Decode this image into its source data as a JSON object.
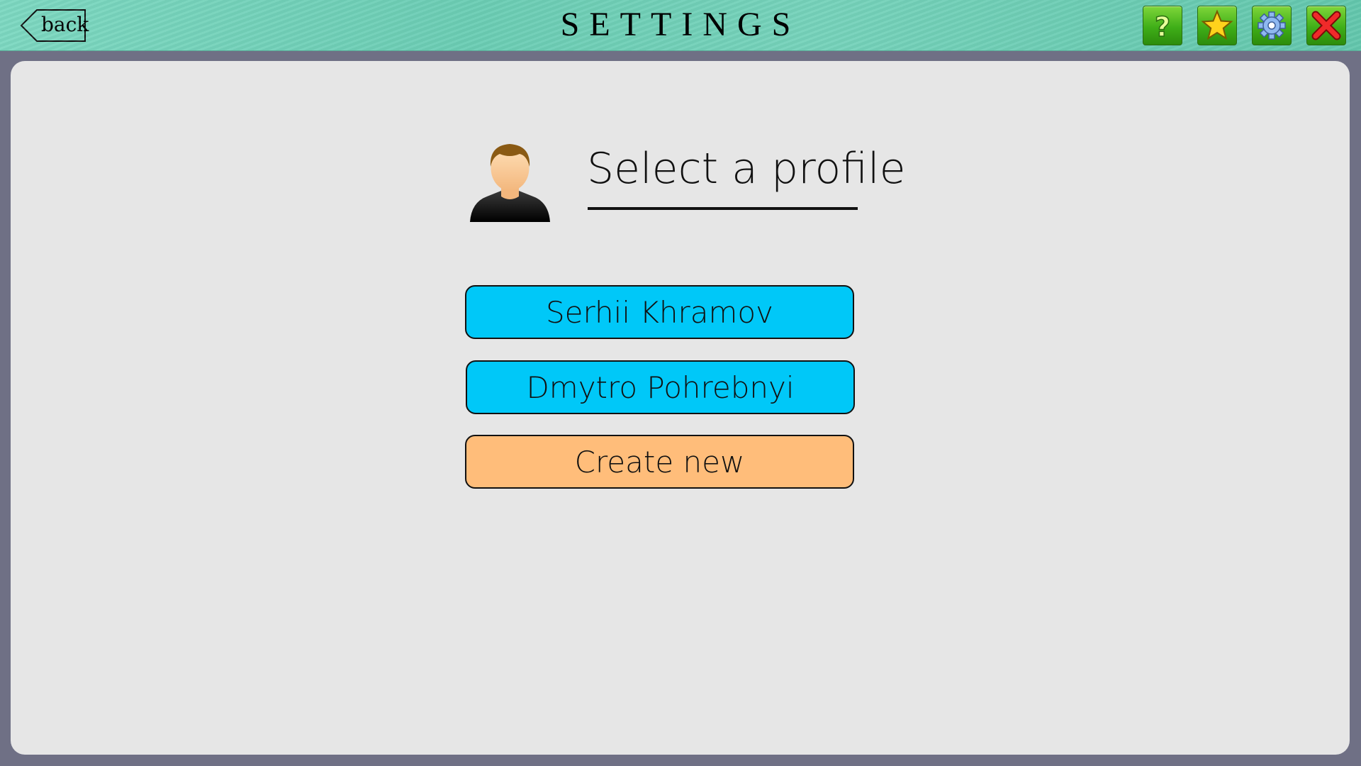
{
  "header": {
    "title": "SETTINGS",
    "back_label": "back",
    "tools": [
      {
        "name": "help",
        "icon": "question-icon"
      },
      {
        "name": "favorites",
        "icon": "star-icon"
      },
      {
        "name": "settings",
        "icon": "gear-icon"
      },
      {
        "name": "close",
        "icon": "close-icon"
      }
    ]
  },
  "main": {
    "heading": "Select a profile",
    "avatar_icon": "user-avatar-icon",
    "profiles": [
      {
        "label": "Serhii Khramov"
      },
      {
        "label": "Dmytro Pohrebnyi"
      }
    ],
    "create_label": "Create new"
  },
  "colors": {
    "header_bg": "#6bcdb4",
    "panel_bg": "#e6e6e6",
    "frame_bg": "#6f7085",
    "profile_button": "#00c8f8",
    "create_button": "#ffbd7a",
    "tool_button": "#3fae18"
  }
}
